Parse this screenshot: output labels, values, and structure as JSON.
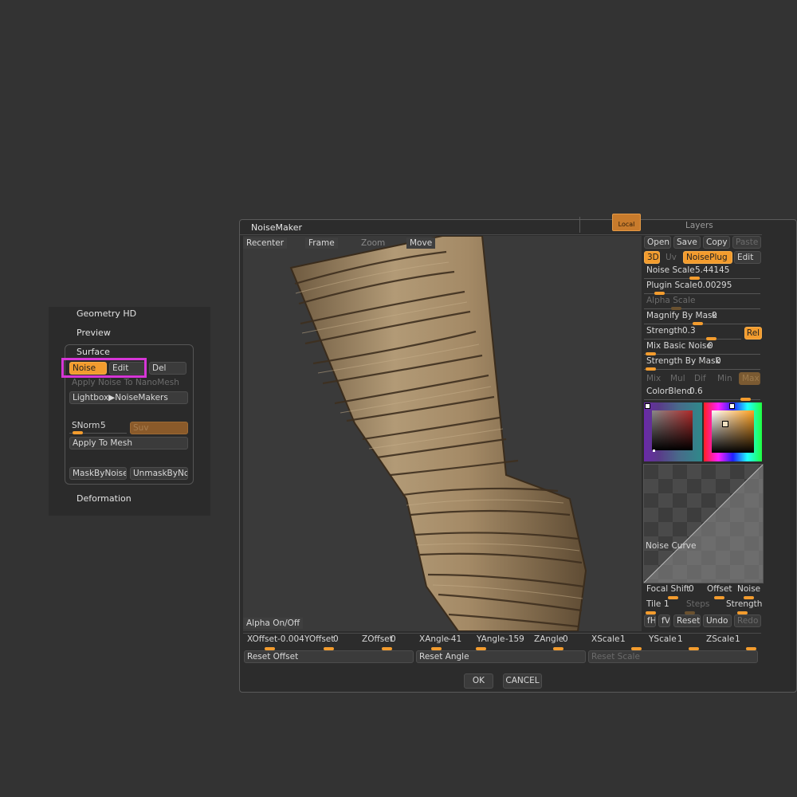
{
  "left_panel": {
    "geometry_hd": "Geometry HD",
    "preview": "Preview",
    "surface": "Surface",
    "noise_btn": "Noise",
    "edit_btn": "Edit",
    "del_btn": "Del",
    "apply_nanomesh": "Apply Noise To NanoMesh",
    "lightbox": "Lightbox▶NoiseMakers",
    "snorm_label": "SNorm",
    "snorm_value": "5",
    "suv_btn": "Suv",
    "apply_mesh": "Apply To Mesh",
    "mask_by_noise": "MaskByNoise",
    "unmask_by_noise": "UnmaskByNois",
    "deformation": "Deformation"
  },
  "dialog": {
    "title": "NoiseMaker",
    "local_label": "Local",
    "layers_label": "Layers",
    "viewport": {
      "recenter": "Recenter",
      "frame": "Frame",
      "zoom": "Zoom",
      "move": "Move",
      "alpha_onoff": "Alpha On/Off"
    },
    "right": {
      "open": "Open",
      "save": "Save",
      "copy": "Copy",
      "paste": "Paste",
      "three_d": "3D",
      "uv": "Uv",
      "noiseplug": "NoisePlug",
      "edit": "Edit",
      "noise_scale_label": "Noise Scale",
      "noise_scale_value": "5.44145",
      "noise_scale_level": 0.42,
      "plugin_scale_label": "Plugin Scale",
      "plugin_scale_value": "0.00295",
      "plugin_scale_level": 0.08,
      "alpha_scale_label": "Alpha Scale",
      "alpha_scale_level": 0.24,
      "magnify_label": "Magnify By Mask",
      "magnify_value": "0",
      "magnify_level": 0.45,
      "strength_label": "Strength",
      "strength_value": "0.3",
      "strength_level": 0.7,
      "rel": "Rel",
      "mix_basic_label": "Mix Basic Noise",
      "mix_basic_value": "0",
      "mix_basic_level": 0.0,
      "strength_mask_label": "Strength By Mask",
      "strength_mask_value": "0",
      "strength_mask_level": 0.0,
      "modes": [
        "Mix",
        "Mul",
        "Dif",
        "Min",
        "Max"
      ],
      "colorblend_label": "ColorBlend",
      "colorblend_value": "0.6",
      "colorblend_level": 0.9,
      "noise_curve": "Noise Curve",
      "focal_shift_label": "Focal Shift",
      "focal_shift_value": "0",
      "offset": "Offset",
      "noise": "Noise",
      "tile_label": "Tile",
      "tile_value": "1",
      "steps": "Steps",
      "strength2": "Strength",
      "fh": "fH",
      "fv": "fV",
      "reset": "Reset",
      "undo": "Undo",
      "redo": "Redo"
    },
    "bottom": {
      "xoffset_label": "XOffset",
      "xoffset_value": "-0.004",
      "yoffset_label": "YOffset",
      "yoffset_value": "0",
      "zoffset_label": "ZOffset",
      "zoffset_value": "0",
      "xangle_label": "XAngle",
      "xangle_value": "-41",
      "yangle_label": "YAngle",
      "yangle_value": "-159",
      "zangle_label": "ZAngle",
      "zangle_value": "0",
      "xscale_label": "XScale",
      "xscale_value": "1",
      "yscale_label": "YScale",
      "yscale_value": "1",
      "zscale_label": "ZScale",
      "zscale_value": "1",
      "reset_offset": "Reset Offset",
      "reset_angle": "Reset Angle",
      "reset_scale": "Reset Scale",
      "ok": "OK",
      "cancel": "CANCEL"
    }
  },
  "colors": {
    "accent": "#f39c2e",
    "highlight": "#d636d6",
    "background": "#333333"
  }
}
